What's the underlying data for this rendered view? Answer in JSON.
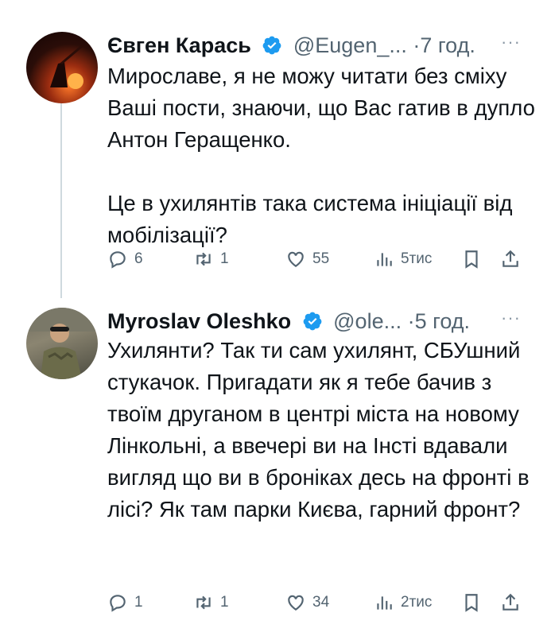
{
  "tweets": [
    {
      "author_name": "Євген Карась",
      "handle": "@Eugen_...",
      "time": "·7 год.",
      "text": "Мирославе, я не можу читати без сміху Ваші пости, знаючи, що Вас гатив в дупло Антон Геращенко.\n\nЦе в ухилянтів така система ініціації від мобілізації?",
      "replies": "6",
      "reposts": "1",
      "likes": "55",
      "views": "5тис",
      "more": "···"
    },
    {
      "author_name": "Myroslav Oleshko",
      "handle": "@ole...",
      "time": "·5 год.",
      "text": "Ухилянти? Так ти сам ухилянт, СБУшний стукачок. Пригадати як я тебе бачив з твоїм друганом в центрі міста на новому Лінкольні, а ввечері ви на Інсті вдавали вигляд що ви в броніках десь на фронті в лісі? Як там парки Києва, гарний фронт?",
      "replies": "1",
      "reposts": "1",
      "likes": "34",
      "views": "2тис",
      "more": "···"
    }
  ],
  "colors": {
    "verified": "#1d9bf0",
    "muted": "#536471",
    "text": "#0f1419"
  }
}
